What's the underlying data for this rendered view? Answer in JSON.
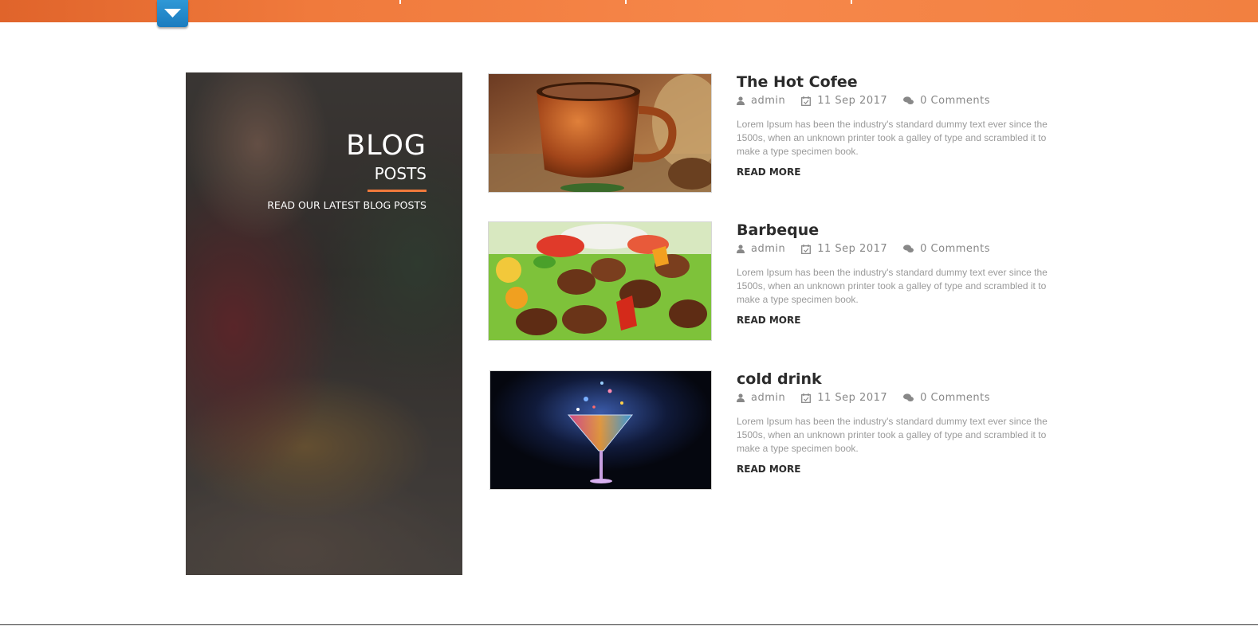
{
  "hero": {
    "title": "BLOG",
    "subtitle": "POSTS",
    "tagline": "READ OUR LATEST BLOG POSTS"
  },
  "colors": {
    "accent": "#f07a3c",
    "toggle": "#1b7cbf",
    "title_text": "#2b2b2b",
    "meta_text": "#888888"
  },
  "posts": [
    {
      "title": "The Hot Cofee",
      "author": "admin",
      "date": "11 Sep 2017",
      "comments": "0 Comments",
      "excerpt": "Lorem Ipsum has been the industry's standard dummy text ever since the 1500s, when an unknown printer took a galley of type and scrambled it to make a type specimen book.",
      "read_more": "READ MORE",
      "image": "hot-coffee-cup"
    },
    {
      "title": "Barbeque",
      "author": "admin",
      "date": "11 Sep 2017",
      "comments": "0 Comments",
      "excerpt": "Lorem Ipsum has been the industry's standard dummy text ever since the 1500s, when an unknown printer took a galley of type and scrambled it to make a type specimen book.",
      "read_more": "READ MORE",
      "image": "barbeque-skewers"
    },
    {
      "title": "cold drink",
      "author": "admin",
      "date": "11 Sep 2017",
      "comments": "0 Comments",
      "excerpt": "Lorem Ipsum has been the industry's standard dummy text ever since the 1500s, when an unknown printer took a galley of type and scrambled it to make a type specimen book.",
      "read_more": "READ MORE",
      "image": "cocktail-glass-splash"
    }
  ]
}
